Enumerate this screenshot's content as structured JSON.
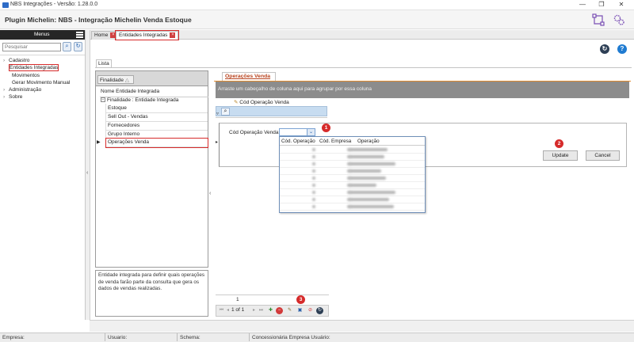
{
  "window": {
    "title": "NBS Integrações - Versão: 1.28.0.0",
    "controls": {
      "minimize": "—",
      "maximize": "❐",
      "close": "✕"
    }
  },
  "header": {
    "title": "Plugin Michelin: NBS - Integração Michelin Venda Estoque"
  },
  "sidebar": {
    "menu_title": "Menus",
    "search_placeholder": "Pesquisar",
    "items": [
      {
        "label": "Cadastro",
        "expandable": true
      },
      {
        "label": "Entidades Integradas",
        "expandable": false
      },
      {
        "label": "Movimentos",
        "expandable": false
      },
      {
        "label": "Gerar Movimento Manual",
        "expandable": false
      },
      {
        "label": "Administração",
        "expandable": true
      },
      {
        "label": "Sobre",
        "expandable": true
      }
    ]
  },
  "tabs": [
    {
      "label": "Home"
    },
    {
      "label": "Entidades Integradas"
    }
  ],
  "lista_tab": "Lista",
  "finalidade": {
    "group_chip": "Finalidade",
    "column_header": "Nome Entidade Integrada",
    "group_row": "Finalidade : Entidade Integrada",
    "items": [
      "Estoque",
      "Sell Out - Vendas",
      "Fornecedores",
      "Grupo Interno",
      "Operações Venda"
    ],
    "selected": "Operações Venda",
    "description": "Entidade integrada para definir quais operações de venda farão parte da consulta que gera os dados de vendas realizadas."
  },
  "operacoes": {
    "tab_label": "Operações Venda",
    "group_hint": "Arraste um cabeçalho de coluna aqui para agrupar por essa coluna",
    "column_header": "Cód Operação Venda",
    "field_label": "Cód Operação Venda",
    "dropdown_columns": [
      "Cód. Operação",
      "Cód. Empresa",
      "Operação"
    ],
    "update_label": "Update",
    "cancel_label": "Cancel"
  },
  "pager": {
    "row_number": "1",
    "page_text": "1 of 1"
  },
  "badges": [
    "1",
    "2",
    "3"
  ],
  "status": {
    "empresa": "Empresa:",
    "usuario": "Usuario:",
    "schema": "Schema:",
    "concessionaria": "Concessionária Empresa Usuário:"
  },
  "colors": {
    "highlight": "#d62b2b",
    "accent_tab": "#b8431e",
    "menubar": "#262626"
  }
}
